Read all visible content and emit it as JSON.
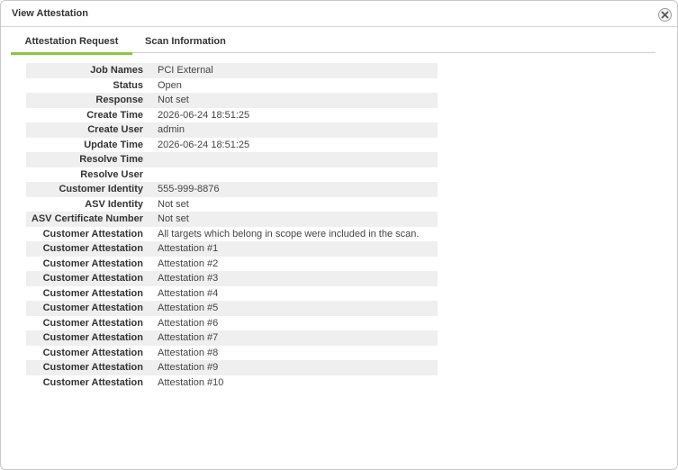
{
  "dialog": {
    "title": "View Attestation",
    "close_icon": "close-icon"
  },
  "tabs": [
    {
      "label": "Attestation Request",
      "active": true
    },
    {
      "label": "Scan Information",
      "active": false
    }
  ],
  "accent_color": "#8cc63f",
  "details": [
    {
      "label": "Job Names",
      "value": "PCI External"
    },
    {
      "label": "Status",
      "value": "Open"
    },
    {
      "label": "Response",
      "value": "Not set"
    },
    {
      "label": "Create Time",
      "value": "2026-06-24 18:51:25"
    },
    {
      "label": "Create User",
      "value": "admin"
    },
    {
      "label": "Update Time",
      "value": "2026-06-24 18:51:25"
    },
    {
      "label": "Resolve Time",
      "value": ""
    },
    {
      "label": "Resolve User",
      "value": ""
    },
    {
      "label": "Customer Identity",
      "value": "555-999-8876"
    },
    {
      "label": "ASV Identity",
      "value": "Not set"
    },
    {
      "label": "ASV Certificate Number",
      "value": "Not set"
    },
    {
      "label": "Customer Attestation",
      "value": "All targets which belong in scope were included in the scan."
    },
    {
      "label": "Customer Attestation",
      "value": "Attestation #1"
    },
    {
      "label": "Customer Attestation",
      "value": "Attestation #2"
    },
    {
      "label": "Customer Attestation",
      "value": "Attestation #3"
    },
    {
      "label": "Customer Attestation",
      "value": "Attestation #4"
    },
    {
      "label": "Customer Attestation",
      "value": "Attestation #5"
    },
    {
      "label": "Customer Attestation",
      "value": "Attestation #6"
    },
    {
      "label": "Customer Attestation",
      "value": "Attestation #7"
    },
    {
      "label": "Customer Attestation",
      "value": "Attestation #8"
    },
    {
      "label": "Customer Attestation",
      "value": "Attestation #9"
    },
    {
      "label": "Customer Attestation",
      "value": "Attestation #10"
    }
  ]
}
